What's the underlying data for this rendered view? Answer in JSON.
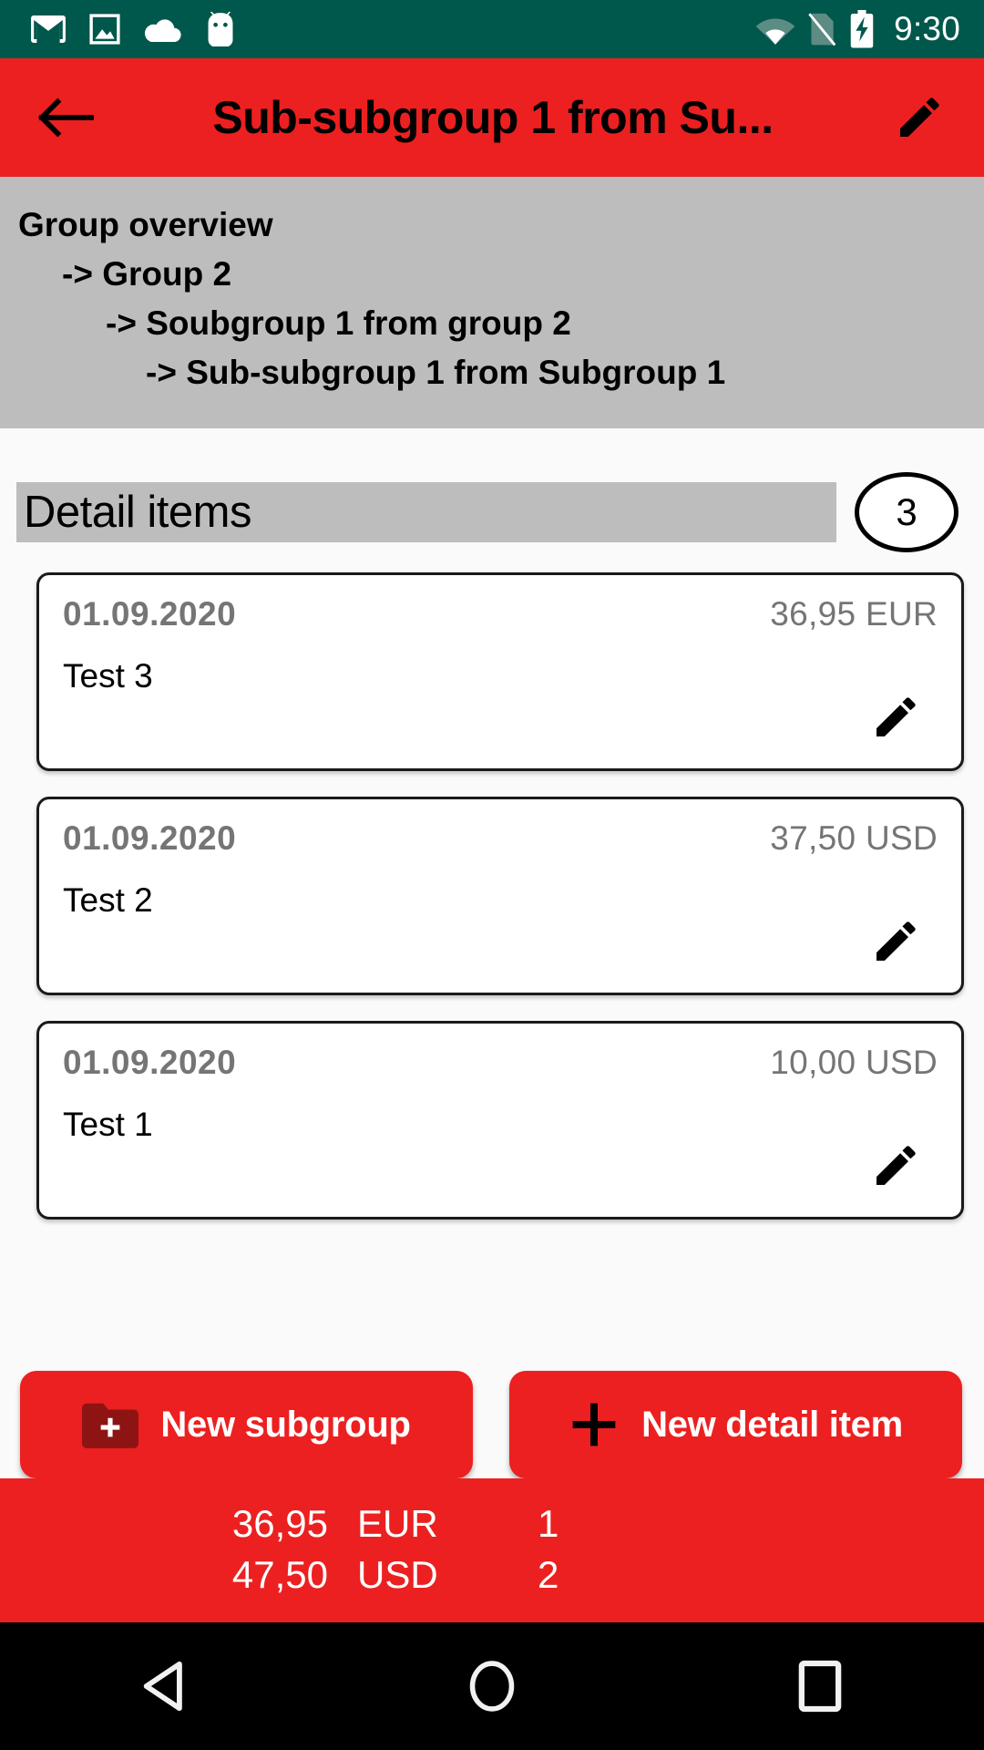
{
  "status_bar": {
    "icons_left": [
      "gmail-icon",
      "gallery-icon",
      "cloud-icon",
      "android-head-icon"
    ],
    "icons_right": [
      "wifi-icon",
      "no-sim-icon",
      "battery-charging-icon"
    ],
    "time": "9:30",
    "background_color": "#00574B"
  },
  "app_bar": {
    "back_icon": "back-arrow-icon",
    "title": "Sub-subgroup 1 from Su...",
    "edit_icon": "pencil-icon",
    "background_color": "#EC2020"
  },
  "breadcrumb": {
    "background_color": "#BDBDBD",
    "lines": [
      {
        "text": "Group overview",
        "indent": 20
      },
      {
        "text": "-> Group 2",
        "indent": 68
      },
      {
        "text": "-> Soubgroup 1 from group 2",
        "indent": 116
      },
      {
        "text": "-> Sub-subgroup 1 from Subgroup 1",
        "indent": 160
      }
    ]
  },
  "detail_section": {
    "title": "Detail items",
    "count": "3",
    "items": [
      {
        "date": "01.09.2020",
        "amount": "36,95 EUR",
        "title": "Test 3",
        "edit_icon": "pencil-icon"
      },
      {
        "date": "01.09.2020",
        "amount": "37,50 USD",
        "title": "Test 2",
        "edit_icon": "pencil-icon"
      },
      {
        "date": "01.09.2020",
        "amount": "10,00 USD",
        "title": "Test 1",
        "edit_icon": "pencil-icon"
      }
    ]
  },
  "actions": {
    "new_subgroup": {
      "label": "New subgroup",
      "icon": "folder-plus-icon"
    },
    "new_detail_item": {
      "label": "New detail item",
      "icon": "plus-icon"
    }
  },
  "summary": {
    "background_color": "#EC2020",
    "rows": [
      {
        "amount": "36,95",
        "currency": "EUR",
        "count": "1"
      },
      {
        "amount": "47,50",
        "currency": "USD",
        "count": "2"
      }
    ]
  },
  "nav_bar": {
    "back": "nav-back-icon",
    "home": "nav-home-icon",
    "recents": "nav-recents-icon"
  }
}
